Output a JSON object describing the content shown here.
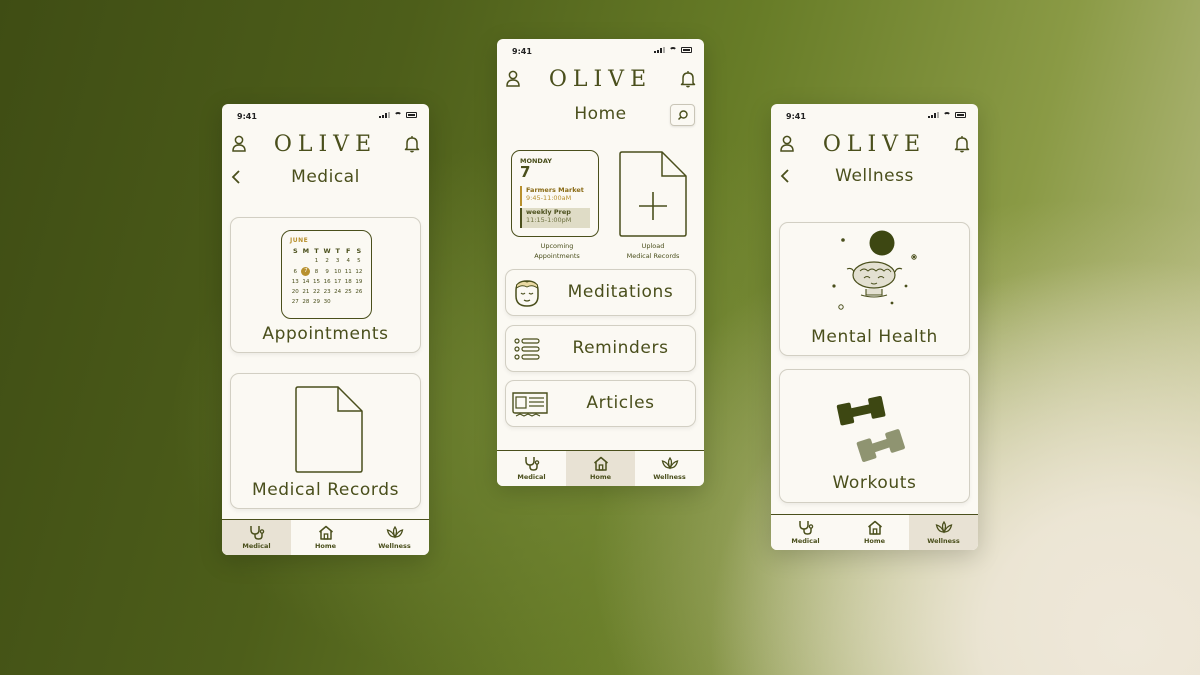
{
  "status": {
    "time": "9:41"
  },
  "app": {
    "logo": "OLIVE"
  },
  "medical": {
    "title": "Medical",
    "calendar": {
      "month": "JUNE",
      "weekdays": [
        "S",
        "M",
        "T",
        "W",
        "T",
        "F",
        "S"
      ],
      "weeks": [
        [
          "",
          "",
          "1",
          "2",
          "3",
          "4",
          "5"
        ],
        [
          "6",
          "7",
          "8",
          "9",
          "10",
          "11",
          "12"
        ],
        [
          "13",
          "14",
          "15",
          "16",
          "17",
          "18",
          "19"
        ],
        [
          "20",
          "21",
          "22",
          "23",
          "24",
          "25",
          "26"
        ],
        [
          "27",
          "28",
          "29",
          "30",
          "",
          "",
          ""
        ]
      ],
      "selected_day": "7"
    },
    "appointments_label": "Appointments",
    "records_label": "Medical Records"
  },
  "home": {
    "title": "Home",
    "widget": {
      "day": "MONDAY",
      "date": "7",
      "events": [
        {
          "name": "Farmers Market",
          "time": "9:45-11:00aM"
        },
        {
          "name": "weekly Prep",
          "time": "11:15-1:00pM"
        }
      ]
    },
    "upcoming_label_1": "Upcoming",
    "upcoming_label_2": "Appointments",
    "upload_label_1": "Upload",
    "upload_label_2": "Medical Records",
    "items": [
      {
        "label": "Meditations"
      },
      {
        "label": "Reminders"
      },
      {
        "label": "Articles"
      }
    ]
  },
  "wellness": {
    "title": "Wellness",
    "mental_label": "Mental Health",
    "workouts_label": "Workouts"
  },
  "tabs": {
    "medical": "Medical",
    "home": "Home",
    "wellness": "Wellness"
  },
  "colors": {
    "olive": "#4a4f1c",
    "accent": "#b8902e",
    "cream": "#fbf9f3",
    "active_tab": "#e8e2d4"
  },
  "icons": [
    "person-icon",
    "bell-icon",
    "search-icon",
    "back-icon",
    "stethoscope-icon",
    "house-icon",
    "lotus-icon",
    "document-icon",
    "plus-icon",
    "face-icon",
    "list-icon",
    "newspaper-icon",
    "brain-icon",
    "dumbbell-icon"
  ]
}
